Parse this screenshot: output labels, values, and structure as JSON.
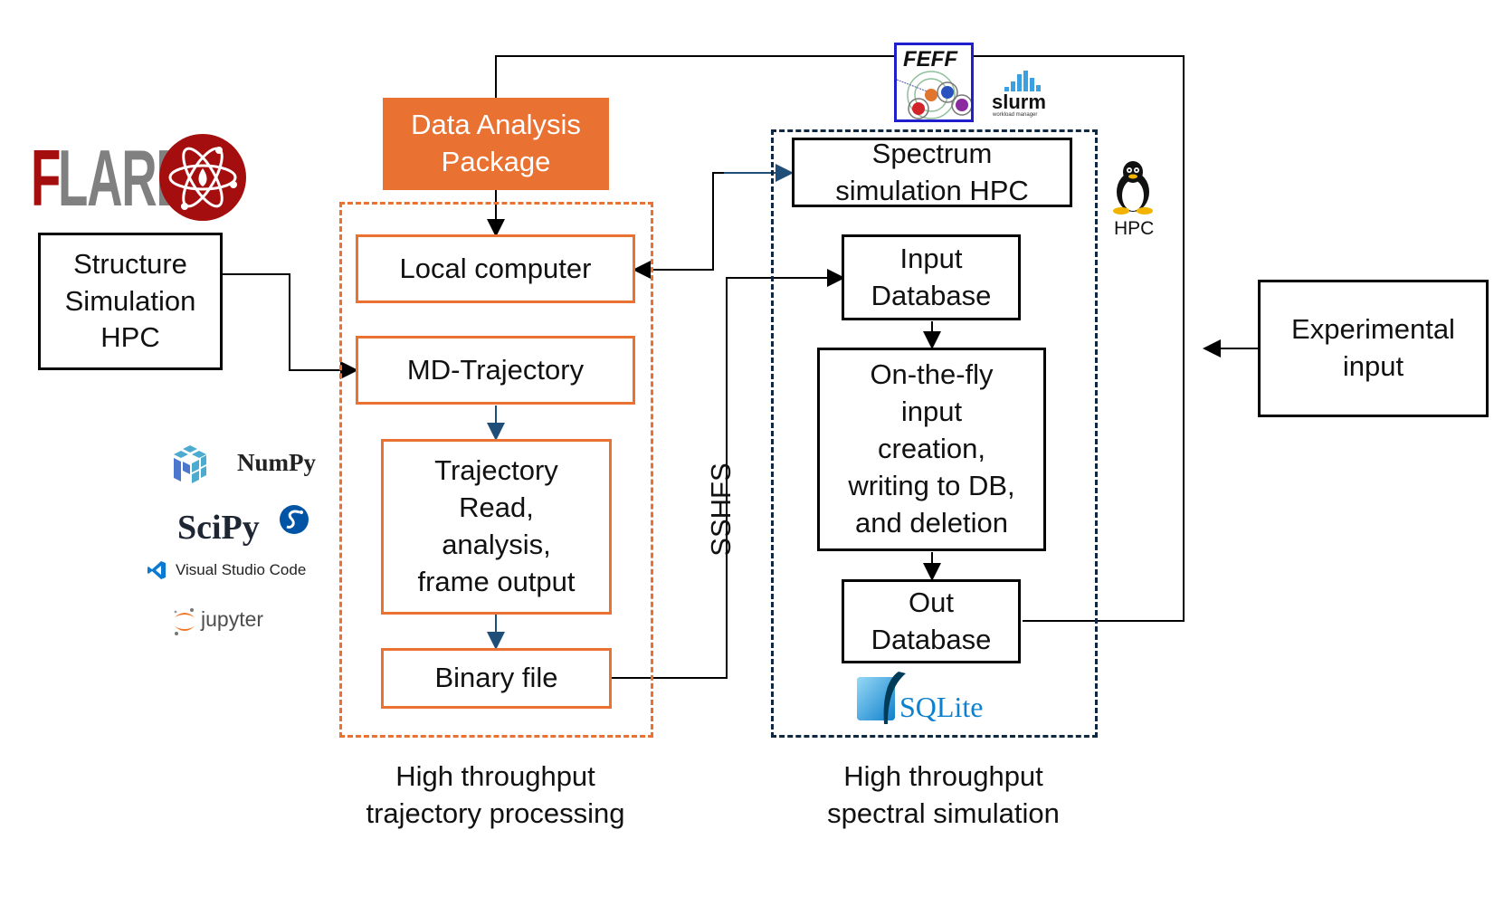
{
  "diagram": {
    "nodes": {
      "data_analysis_package": "Data Analysis\nPackage",
      "local_computer": "Local computer",
      "md_trajectory": "MD-Trajectory",
      "trajectory_read": "Trajectory\nRead,\nanalysis,\nframe output",
      "binary_file": "Binary file",
      "structure_simulation_hpc": "Structure\nSimulation\nHPC",
      "spectrum_simulation_hpc": "Spectrum\nsimulation HPC",
      "input_database": "Input\nDatabase",
      "on_the_fly": "On-the-fly\ninput\ncreation,\nwriting to DB,\nand deletion",
      "out_database": "Out\nDatabase",
      "experimental_input": "Experimental\ninput"
    },
    "connector_labels": {
      "sshfs": "SSHFS"
    },
    "group_captions": {
      "trajectory_group": "High throughput\ntrajectory processing",
      "spectral_group": "High throughput\nspectral simulation"
    },
    "logos": {
      "flare_f": "F",
      "flare_rest": "LARE",
      "feff": "FEFF",
      "slurm": "slurm",
      "slurm_sub": "workload manager",
      "hpc": "HPC",
      "numpy": "NumPy",
      "scipy": "SciPy",
      "vscode": "Visual Studio Code",
      "jupyter": "jupyter",
      "sqlite": "SQLite"
    },
    "colors": {
      "orange": "#e97132",
      "navy": "#0e2841",
      "flare_red": "#a50e0e",
      "flare_grey": "#808080",
      "feff_border": "#1f1fd0"
    }
  }
}
